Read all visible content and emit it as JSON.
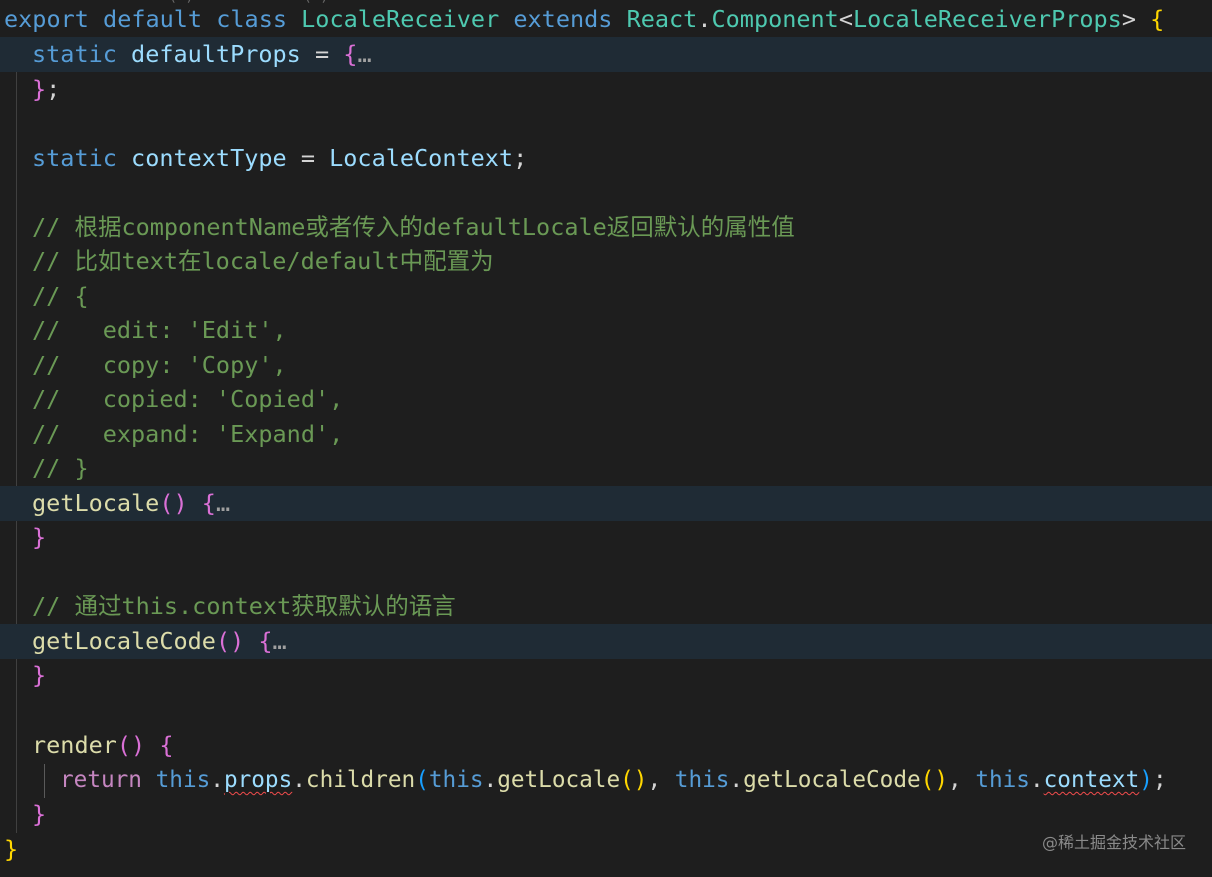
{
  "top_partial_text": "                    ( )             ( )",
  "code": {
    "l1": {
      "export": "export",
      "default": "default",
      "class": "class",
      "name": "LocaleReceiver",
      "extends": "extends",
      "react": "React",
      "dot": ".",
      "component": "Component",
      "lt": "<",
      "props_type": "LocaleReceiverProps",
      "gt": ">",
      "space": " ",
      "brace": "{"
    },
    "l2": {
      "static": "static",
      "prop": "defaultProps",
      "eq": " = ",
      "brace": "{",
      "fold": "…"
    },
    "l3": {
      "brace": "}",
      "semi": ";"
    },
    "l5": {
      "static": "static",
      "prop": "contextType",
      "eq": " = ",
      "value": "LocaleContext",
      "semi": ";"
    },
    "l7": "// 根据componentName或者传入的defaultLocale返回默认的属性值",
    "l8": "// 比如text在locale/default中配置为",
    "l9": "// {",
    "l10": "//   edit: 'Edit',",
    "l11": "//   copy: 'Copy',",
    "l12": "//   copied: 'Copied',",
    "l13": "//   expand: 'Expand',",
    "l14": "// }",
    "l15": {
      "fn": "getLocale",
      "parens": "()",
      "brace": "{",
      "fold": "…"
    },
    "l16": {
      "brace": "}"
    },
    "l18": "// 通过this.context获取默认的语言",
    "l19": {
      "fn": "getLocaleCode",
      "parens": "()",
      "brace": "{",
      "fold": "…"
    },
    "l20": {
      "brace": "}"
    },
    "l22": {
      "fn": "render",
      "parens": "()",
      "brace": "{"
    },
    "l23": {
      "return": "return",
      "this1": "this",
      "dot": ".",
      "props": "props",
      "children": "children",
      "open": "(",
      "this2": "this",
      "getLocale": "getLocale",
      "call": "()",
      "comma": ", ",
      "this3": "this",
      "getLocaleCode": "getLocaleCode",
      "this4": "this",
      "context": "context",
      "close": ")",
      "semi": ";"
    },
    "l24": {
      "brace": "}"
    },
    "l25": {
      "brace": "}"
    }
  },
  "watermark": "@稀土掘金技术社区"
}
